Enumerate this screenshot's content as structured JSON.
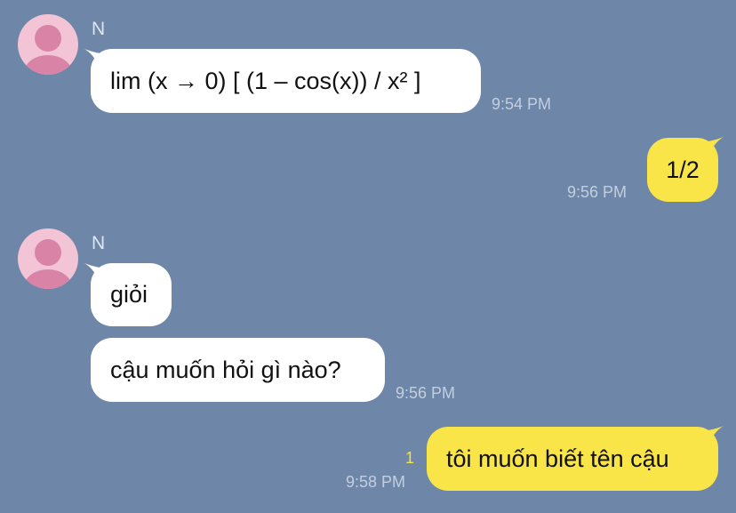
{
  "colors": {
    "background": "#6e86a8",
    "incoming_bubble": "#ffffff",
    "outgoing_bubble": "#f9e547",
    "avatar_bg": "#f2c4d5",
    "avatar_fg": "#d984a6",
    "timestamp": "#c3cfdf",
    "unread_count": "#f5e34a"
  },
  "messages": {
    "m1": {
      "sender": "N",
      "avatar_icon": "default-user-avatar",
      "text": "lim (x → 0) [ (1 – cos(x)) / x² ]",
      "time": "9:54 PM"
    },
    "m2": {
      "text": "1/2",
      "time": "9:56 PM"
    },
    "m3": {
      "sender": "N",
      "avatar_icon": "default-user-avatar",
      "text": "giỏi"
    },
    "m4": {
      "text": "cậu muốn hỏi gì nào?",
      "time": "9:56 PM"
    },
    "m5": {
      "text": "tôi muốn biết tên cậu",
      "time": "9:58 PM",
      "unread": "1"
    }
  }
}
